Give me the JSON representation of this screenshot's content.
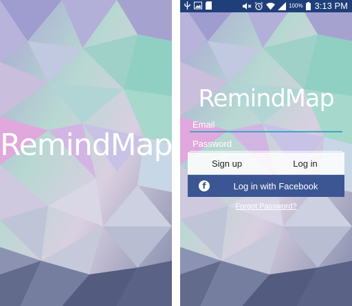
{
  "app_name": "RemindMap",
  "status_bar": {
    "battery_percent": "100%",
    "time": "3:13 PM",
    "left_icons": [
      "usb-icon",
      "image-icon",
      "sd-card-icon"
    ],
    "right_icons": [
      "mute-icon",
      "alarm-icon",
      "wifi-icon",
      "signal-icon",
      "battery-icon"
    ]
  },
  "login": {
    "email_placeholder": "Email",
    "password_placeholder": "Password",
    "signup_label": "Sign up",
    "login_label": "Log in",
    "facebook_label": "Log in with Facebook",
    "facebook_icon": "f",
    "forgot_label": "Forgot Password?"
  },
  "colors": {
    "status_bar": "#1f3f7a",
    "facebook": "#3b5693",
    "email_underline": "#3aa6c6"
  }
}
